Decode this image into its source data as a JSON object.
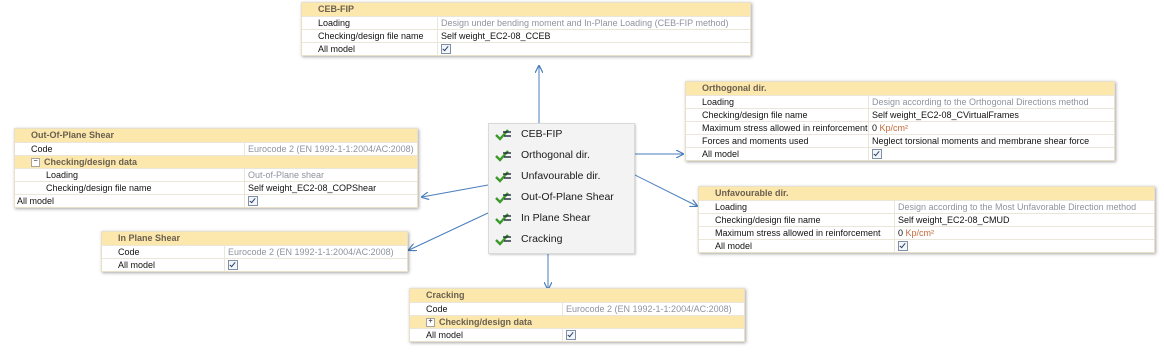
{
  "menu": {
    "items": [
      "CEB-FIP",
      "Orthogonal dir.",
      "Unfavourable dir.",
      "Out-Of-Plane Shear",
      "In Plane Shear",
      "Cracking"
    ]
  },
  "ceb": {
    "title": "CEB-FIP",
    "loading_label": "Loading",
    "loading_value": "Design under bending moment and In-Plane Loading (CEB-FIP method)",
    "file_label": "Checking/design file name",
    "file_value": "Self weight_EC2-08_CCEB",
    "all_label": "All model",
    "all_checked": true
  },
  "ortho": {
    "title": "Orthogonal dir.",
    "loading_label": "Loading",
    "loading_value": "Design according to the Orthogonal Directions method",
    "file_label": "Checking/design file name",
    "file_value": "Self weight_EC2-08_CVirtualFrames",
    "stress_label": "Maximum stress allowed in reinforcement",
    "stress_value": "0",
    "stress_unit": "Kp/cm²",
    "forces_label": "Forces and moments used",
    "forces_value": "Neglect torsional moments and membrane shear force",
    "all_label": "All model",
    "all_checked": true
  },
  "unfav": {
    "title": "Unfavourable dir.",
    "loading_label": "Loading",
    "loading_value": "Design according to the Most Unfavorable Direction method",
    "file_label": "Checking/design file name",
    "file_value": "Self weight_EC2-08_CMUD",
    "stress_label": "Maximum stress allowed in reinforcement",
    "stress_value": "0",
    "stress_unit": "Kp/cm²",
    "all_label": "All model",
    "all_checked": true
  },
  "oop": {
    "title": "Out-Of-Plane Shear",
    "code_label": "Code",
    "code_value": "Eurocode 2 (EN 1992-1-1:2004/AC:2008)",
    "group_label": "Checking/design data",
    "group_expander": "−",
    "loading_label": "Loading",
    "loading_value": "Out-of-Plane shear",
    "file_label": "Checking/design file name",
    "file_value": "Self weight_EC2-08_COPShear",
    "all_label": "All model",
    "all_checked": true
  },
  "ips": {
    "title": "In Plane Shear",
    "code_label": "Code",
    "code_value": "Eurocode 2 (EN 1992-1-1:2004/AC:2008)",
    "all_label": "All model",
    "all_checked": true
  },
  "crack": {
    "title": "Cracking",
    "code_label": "Code",
    "code_value": "Eurocode 2 (EN 1992-1-1:2004/AC:2008)",
    "group_label": "Checking/design data",
    "group_expander": "+",
    "all_label": "All model",
    "all_checked": true
  },
  "colors": {
    "header_bg": "#fce7ac",
    "arrow": "#4a7ebb",
    "check_green": "#3c9a2a",
    "muted_text": "#8f93a0",
    "unit_text": "#c46a3a"
  },
  "icons": {
    "menu_item": "green-check-reinforcement-icon"
  }
}
